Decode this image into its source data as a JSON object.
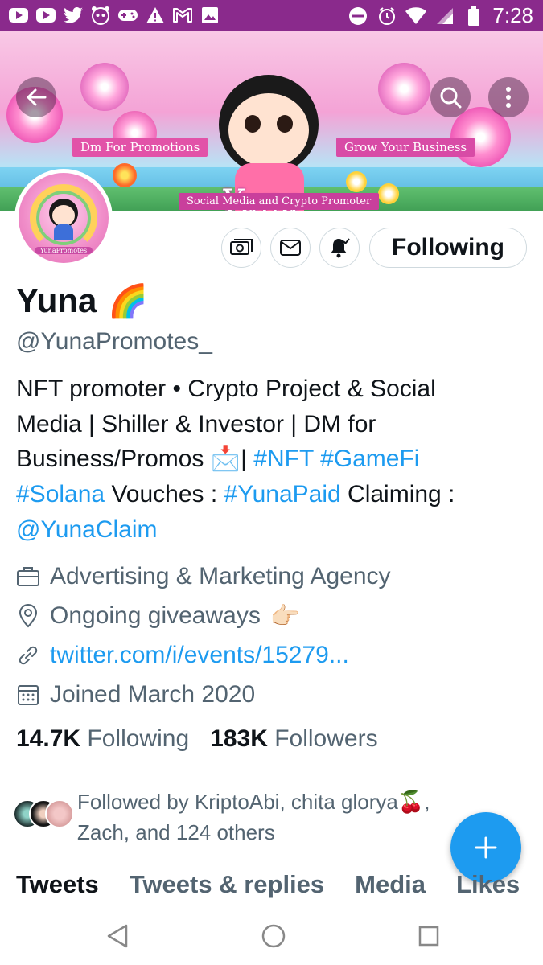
{
  "status_bar": {
    "time": "7:28",
    "icons": [
      "youtube-icon",
      "youtube-icon",
      "twitter-icon",
      "panda-icon",
      "gamepad-icon",
      "warning-icon",
      "gmail-icon",
      "image-icon",
      "dnd-icon",
      "alarm-icon",
      "wifi-icon",
      "signal-icon",
      "battery-icon"
    ]
  },
  "banner": {
    "ribbon_left": "Dm For Promotions",
    "ribbon_right": "Grow Your Business",
    "logo_text": "Yuna",
    "tagline": "Social Media and Crypto Promoter"
  },
  "avatar": {
    "label": "YunaPromotes"
  },
  "actions": {
    "follow_label": "Following"
  },
  "profile": {
    "name": "Yuna",
    "name_emoji": "🌈",
    "handle": "@YunaPromotes_",
    "bio_line1": "NFT promoter • Crypto Project & Social",
    "bio_line2": "Media | Shiller & Investor | DM for",
    "bio_line3_text": "Business/Promos ",
    "bio_line3_emoji": "📩",
    "bio_line3_sep": "| ",
    "bio_tag_nft": "#NFT",
    "bio_tag_gamefi": "#GameFi",
    "bio_tag_solana": "#Solana",
    "bio_vouches": " Vouches : ",
    "bio_tag_yunapaid": "#YunaPaid",
    "bio_claiming": " Claiming :",
    "bio_mention": "@YunaClaim",
    "category": "Advertising & Marketing Agency",
    "location": "Ongoing giveaways",
    "location_emoji": "👉🏻",
    "url": "twitter.com/i/events/15279...",
    "joined": "Joined March 2020"
  },
  "stats": {
    "following_count": "14.7K",
    "following_label": "Following",
    "followers_count": "183K",
    "followers_label": "Followers"
  },
  "followed_by": {
    "line1": "Followed by KriptoAbi, chita glorya🍒,",
    "line2": "Zach, and 124 others"
  },
  "tabs": [
    "Tweets",
    "Tweets & replies",
    "Media",
    "Likes"
  ],
  "colors": {
    "accent": "#1d9bf0",
    "status_bar": "#8a2a8c",
    "muted": "#536471",
    "text": "#0f1419"
  }
}
